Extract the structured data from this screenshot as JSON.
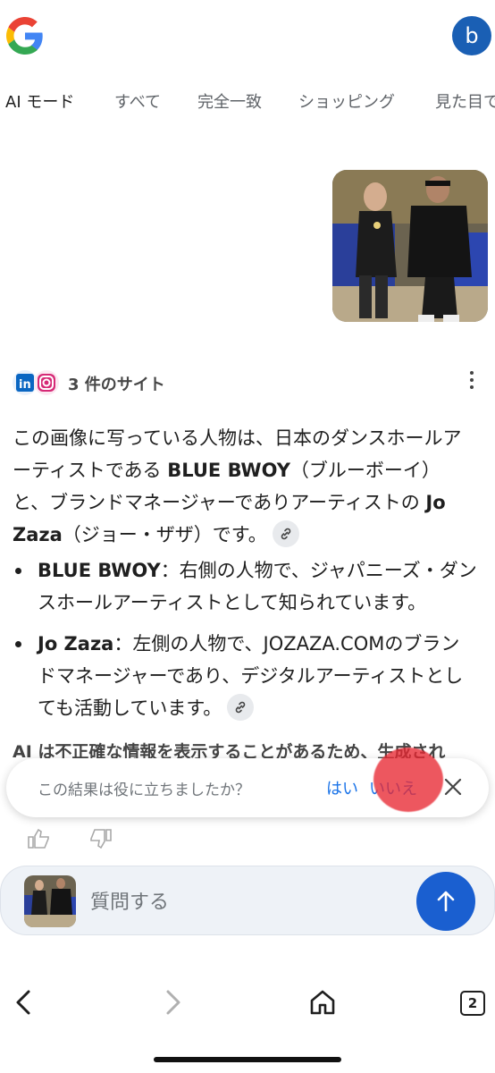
{
  "header": {
    "logo_icon": "google-g-logo-icon",
    "avatar_letter": "b",
    "avatar_color": "#1a5fb4"
  },
  "tabs": [
    {
      "label": "AI モード",
      "active": true
    },
    {
      "label": "すべて"
    },
    {
      "label": "完全一致"
    },
    {
      "label": "ショッピング"
    },
    {
      "label": "見た目で"
    }
  ],
  "sources": {
    "icons": [
      "linkedin-icon",
      "instagram-icon"
    ],
    "label": "3 件のサイト"
  },
  "answer": {
    "p1_a": "この画像に写っている人物は、日本のダンスホールアーティストである ",
    "p1_name1": "BLUE BWOY",
    "p1_b": "（ブルーボーイ）と、ブランドマネージャーでありアーティストの ",
    "p1_name2": "Jo Zaza",
    "p1_c": "（ジョー・ザザ）です。",
    "bullets": [
      {
        "name": "BLUE BWOY",
        "text": "：右側の人物で、ジャパニーズ・ダンスホールアーティストとして知られています。"
      },
      {
        "name": "Jo Zaza",
        "text": "：左側の人物で、JOZAZA.COMのブランドマネージャーであり、デジタルアーティストとしても活動しています。"
      }
    ],
    "disclaimer": "AI は不正確な情報を表示することがあるため、生成され"
  },
  "feedback": {
    "question": "この結果は役に立ちましたか？",
    "yes": "はい",
    "no": "いいえ"
  },
  "ask": {
    "placeholder": "質問する"
  },
  "nav": {
    "tab_count": "2"
  },
  "colors": {
    "accent": "#1a73e8",
    "send_button": "#1a5fd0",
    "annotation_red": "#e82832"
  }
}
